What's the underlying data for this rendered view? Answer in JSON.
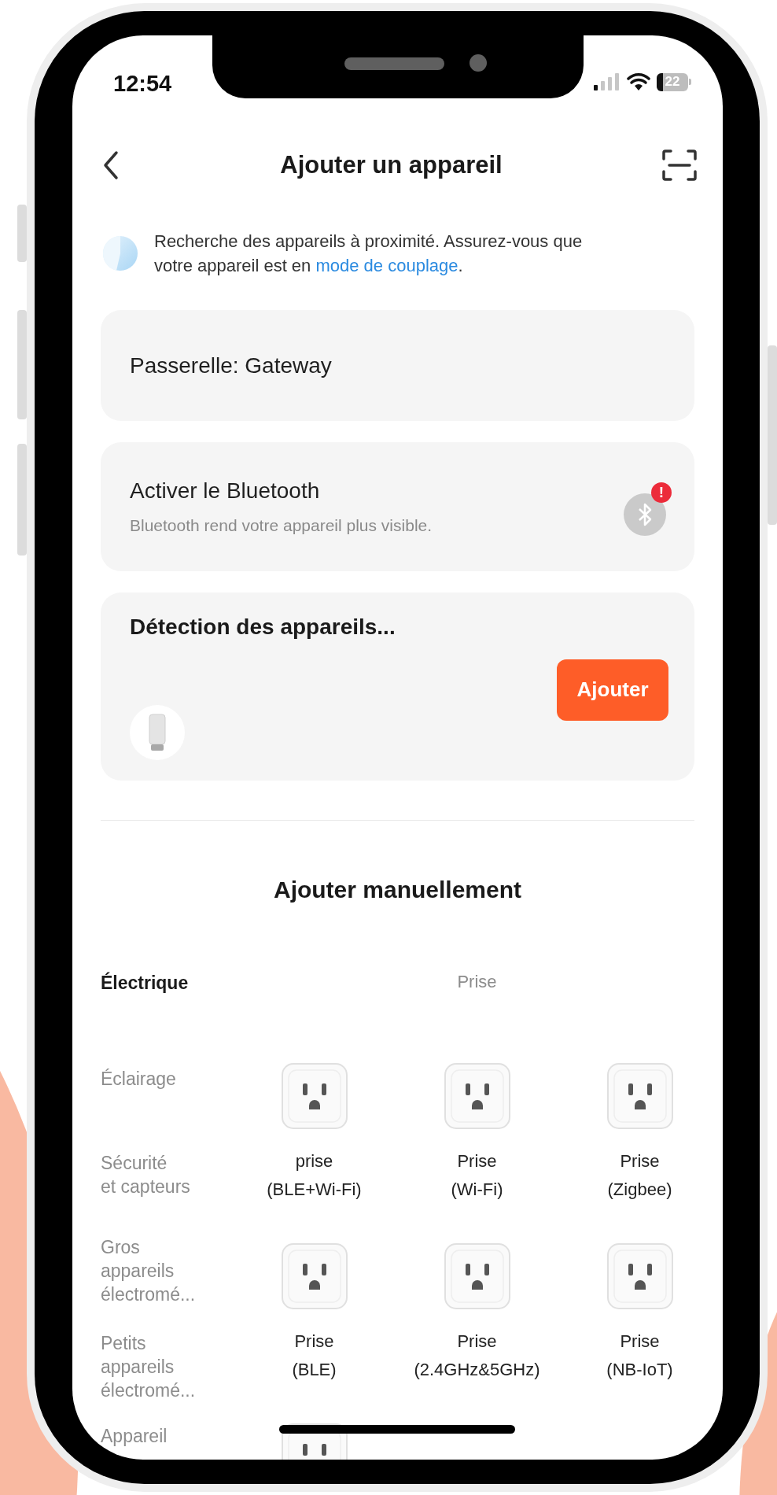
{
  "status_bar": {
    "time": "12:54",
    "battery": "22"
  },
  "header": {
    "title": "Ajouter un appareil"
  },
  "notice": {
    "text": "Recherche des appareils à proximité. Assurez-vous que votre appareil est en ",
    "link": "mode de couplage",
    "end": "."
  },
  "gateway_card": {
    "label": "Passerelle: Gateway"
  },
  "bluetooth_card": {
    "title": "Activer le Bluetooth",
    "subtitle": "Bluetooth rend votre appareil plus visible.",
    "badge": "!"
  },
  "detection_card": {
    "title": "Détection des appareils...",
    "button": "Ajouter"
  },
  "manual": {
    "title": "Ajouter manuellement",
    "group_title": "Prise",
    "categories": [
      {
        "label": "Électrique",
        "selected": true
      },
      {
        "label": "Éclairage",
        "selected": false
      },
      {
        "label": "Sécurité\net capteurs",
        "selected": false
      },
      {
        "label": "Gros\nappareils\nélectromé...",
        "selected": false
      },
      {
        "label": "Petits\nappareils\nélectromé...",
        "selected": false
      },
      {
        "label": "Appareil",
        "selected": false
      }
    ],
    "devices": [
      {
        "label": "prise\n(BLE+Wi-Fi)"
      },
      {
        "label": "Prise\n(Wi-Fi)"
      },
      {
        "label": "Prise\n(Zigbee)"
      },
      {
        "label": "Prise\n(BLE)"
      },
      {
        "label": "Prise\n(2.4GHz&5GHz)"
      },
      {
        "label": "Prise\n(NB-IoT)"
      }
    ]
  }
}
